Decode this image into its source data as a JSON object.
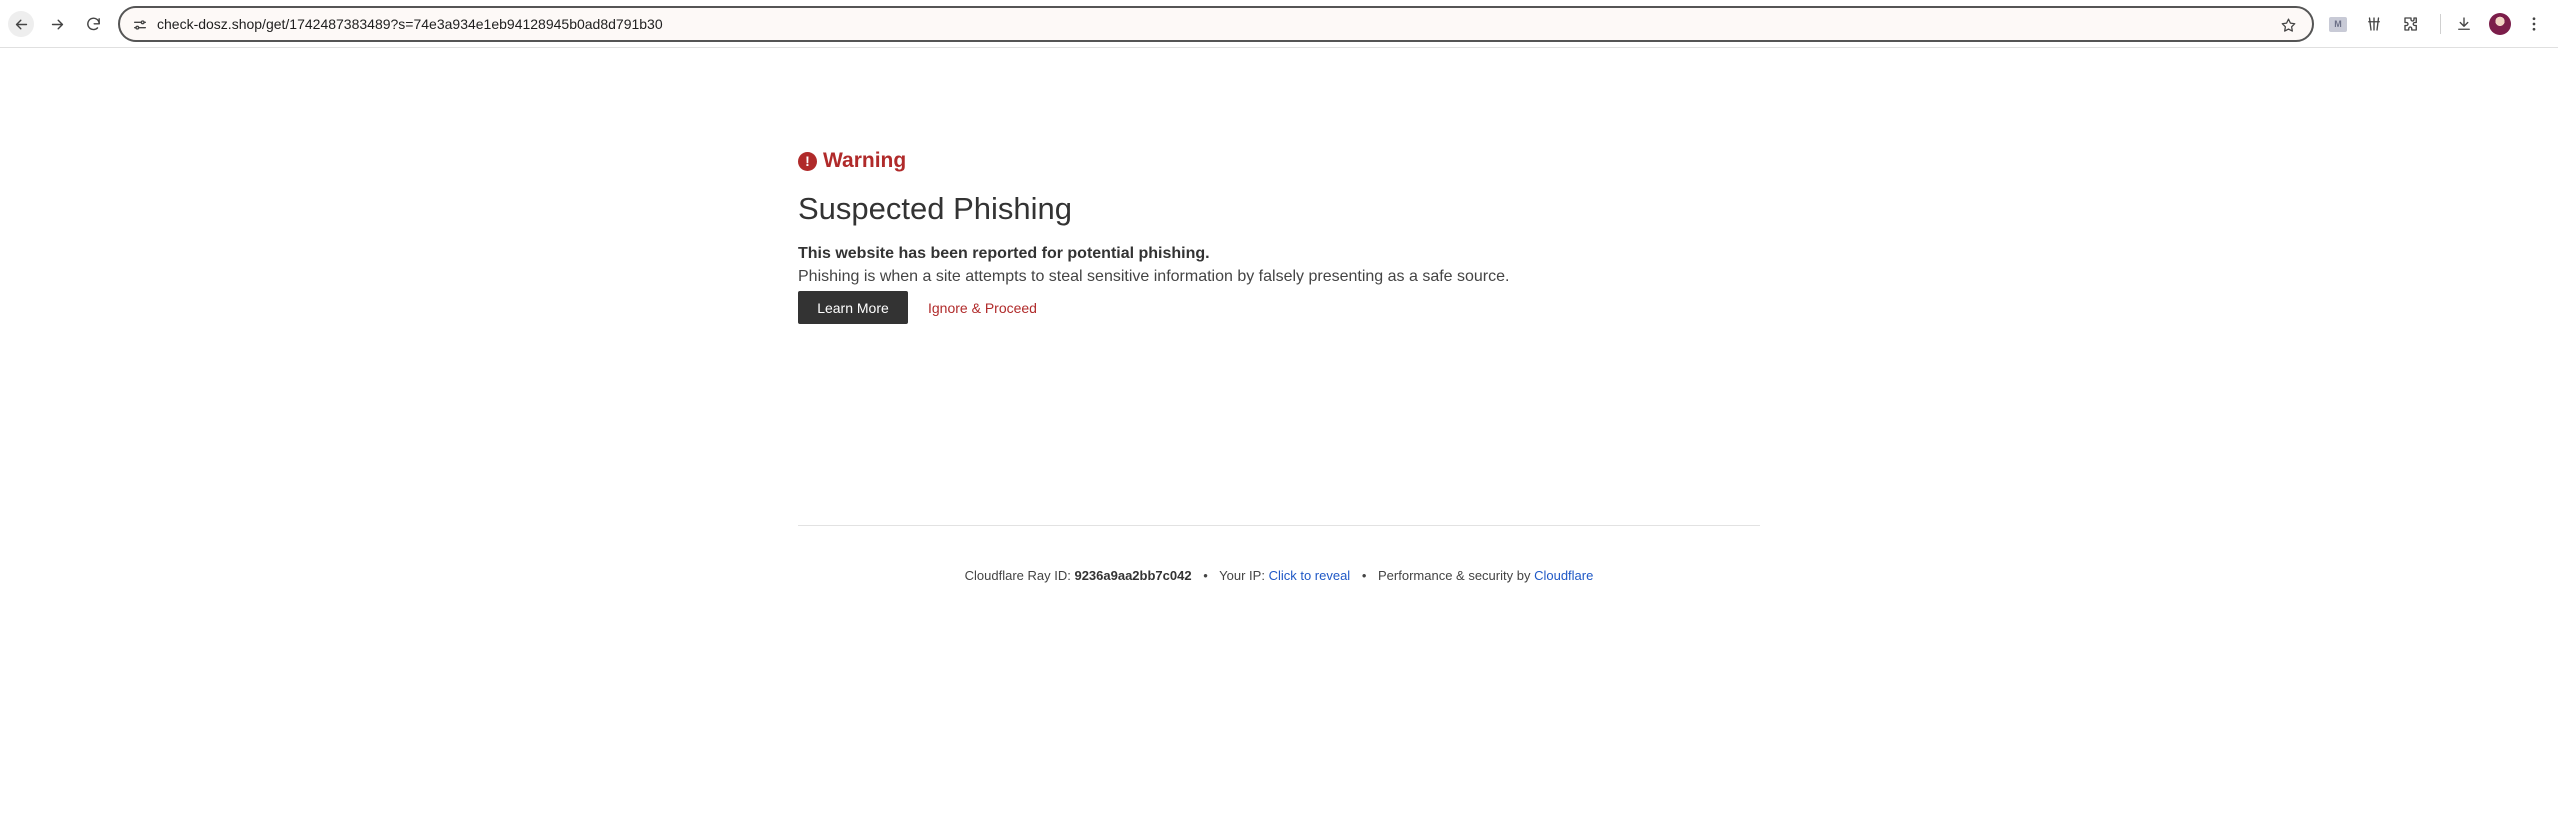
{
  "browser": {
    "url": "check-dosz.shop/get/1742487383489?s=74e3a934e1eb94128945b0ad8d791b30",
    "extension_badge": "M"
  },
  "page": {
    "warning_label": "Warning",
    "title": "Suspected Phishing",
    "lead": "This website has been reported for potential phishing.",
    "description": "Phishing is when a site attempts to steal sensitive information by falsely presenting as a safe source.",
    "learn_more": "Learn More",
    "ignore_proceed": "Ignore & Proceed"
  },
  "footer": {
    "ray_label": "Cloudflare Ray ID:",
    "ray_id": "9236a9aa2bb7c042",
    "separator": "•",
    "ip_label": "Your IP:",
    "ip_link": "Click to reveal",
    "perf_label": "Performance & security by",
    "cloudflare_link": "Cloudflare"
  },
  "colors": {
    "warning_red": "#b02a2a",
    "link_blue": "#1f58c6",
    "button_dark": "#333333"
  },
  "icons": [
    "back-arrow-icon",
    "forward-arrow-icon",
    "reload-icon",
    "site-info-icon",
    "bookmark-star-icon",
    "extension-icon",
    "extensions-puzzle-icon",
    "download-icon",
    "more-menu-icon",
    "warning-exclamation-icon"
  ]
}
